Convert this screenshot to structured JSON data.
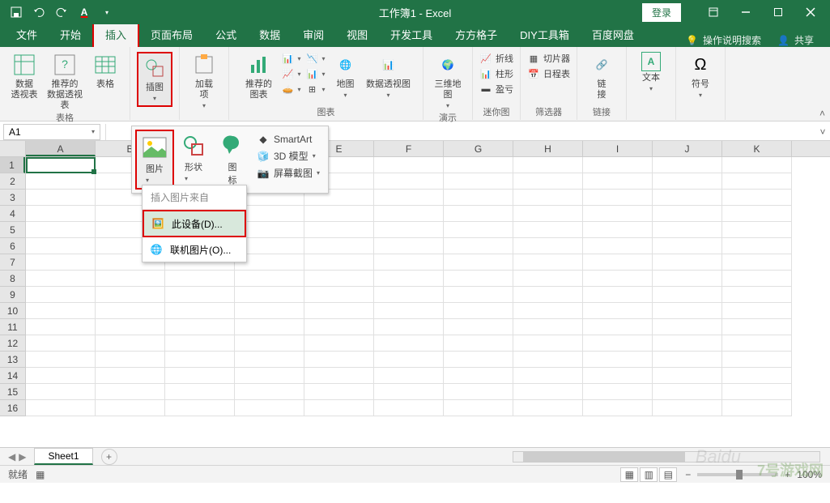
{
  "title": "工作簿1 - Excel",
  "login": "登录",
  "tabs": [
    "文件",
    "开始",
    "插入",
    "页面布局",
    "公式",
    "数据",
    "审阅",
    "视图",
    "开发工具",
    "方方格子",
    "DIY工具箱",
    "百度网盘"
  ],
  "activeTab": "插入",
  "tellMe": "操作说明搜索",
  "share": "共享",
  "ribbon": {
    "group1": {
      "label": "表格",
      "items": [
        "数据\n透视表",
        "推荐的\n数据透视表",
        "表格"
      ]
    },
    "group2": {
      "label": "",
      "items": [
        "插图"
      ]
    },
    "group3": {
      "label": "",
      "items": [
        "加载\n项"
      ]
    },
    "group4": {
      "label": "图表",
      "items": [
        "推荐的\n图表"
      ],
      "small": [
        "",
        "",
        "",
        "地图",
        "数据透视图"
      ]
    },
    "group5": {
      "label": "演示",
      "items": [
        "三维地\n图"
      ]
    },
    "group6": {
      "label": "迷你图",
      "small": [
        "折线",
        "柱形",
        "盈亏"
      ]
    },
    "group7": {
      "label": "筛选器",
      "small": [
        "切片器",
        "日程表"
      ]
    },
    "group8": {
      "label": "链接",
      "items": [
        "链\n接"
      ]
    },
    "group9": {
      "label": "",
      "items": [
        "文本"
      ]
    },
    "group10": {
      "label": "",
      "items": [
        "符号"
      ]
    }
  },
  "subRibbon": {
    "pic": "图片",
    "shapes": "形状",
    "icons": "图\n标",
    "smart": "SmartArt",
    "model": "3D 模型",
    "screenshot": "屏幕截图"
  },
  "ctxMenu": {
    "header": "插入图片来自",
    "device": "此设备(D)...",
    "online": "联机图片(O)..."
  },
  "nameBox": "A1",
  "columns": [
    "A",
    "B",
    "C",
    "D",
    "E",
    "F",
    "G",
    "H",
    "I",
    "J",
    "K"
  ],
  "rows": [
    "1",
    "2",
    "3",
    "4",
    "5",
    "6",
    "7",
    "8",
    "9",
    "10",
    "11",
    "12",
    "13",
    "14",
    "15",
    "16"
  ],
  "sheet": "Sheet1",
  "status": "就绪",
  "recMacro": "",
  "zoom": "100%",
  "watermark": "7号游戏网",
  "watermarkSub": "Baidu"
}
